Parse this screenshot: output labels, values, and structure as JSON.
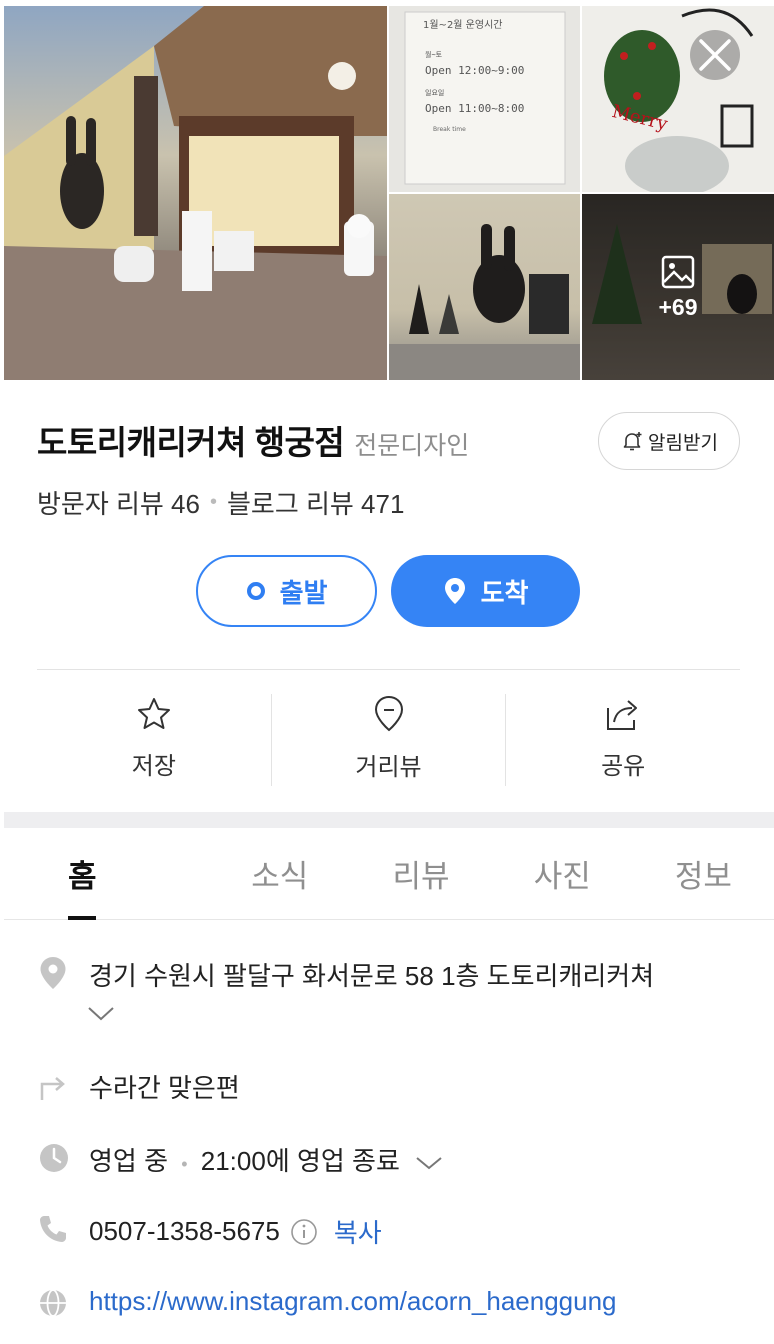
{
  "gallery": {
    "more_count": "+69",
    "menu_photo_text": {
      "heading": "1월~2월 운영시간",
      "weekday_label": "월~토",
      "weekday_hours": "Open 12:00~9:00",
      "sunday_label": "일요일",
      "sunday_hours": "Open 11:00~8:00",
      "break": "Break time"
    }
  },
  "place": {
    "name": "도토리캐리커쳐 행궁점",
    "category": "전문디자인",
    "alarm_label": "알림받기",
    "visitor_review": "방문자 리뷰 46",
    "blog_review": "블로그 리뷰 471"
  },
  "route": {
    "depart_label": "출발",
    "arrive_label": "도착"
  },
  "actions": [
    {
      "label": "저장",
      "icon": "star-icon"
    },
    {
      "label": "거리뷰",
      "icon": "street-view-pin-icon"
    },
    {
      "label": "공유",
      "icon": "share-icon"
    }
  ],
  "tabs": [
    {
      "label": "홈",
      "active": true
    },
    {
      "label": "소식",
      "active": false
    },
    {
      "label": "리뷰",
      "active": false
    },
    {
      "label": "사진",
      "active": false
    },
    {
      "label": "정보",
      "active": false
    }
  ],
  "info": {
    "address": "경기 수원시 팔달구 화서문로 58 1층 도토리캐리커쳐",
    "directions": "수라간 맞은편",
    "status": "영업 중",
    "hours": "21:00에 영업 종료",
    "phone": "0507-1358-5675",
    "copy_label": "복사",
    "website": "https://www.instagram.com/acorn_haenggung"
  },
  "colors": {
    "accent": "#3584f5",
    "link": "#2b6acb",
    "muted": "#8e8e8e"
  }
}
